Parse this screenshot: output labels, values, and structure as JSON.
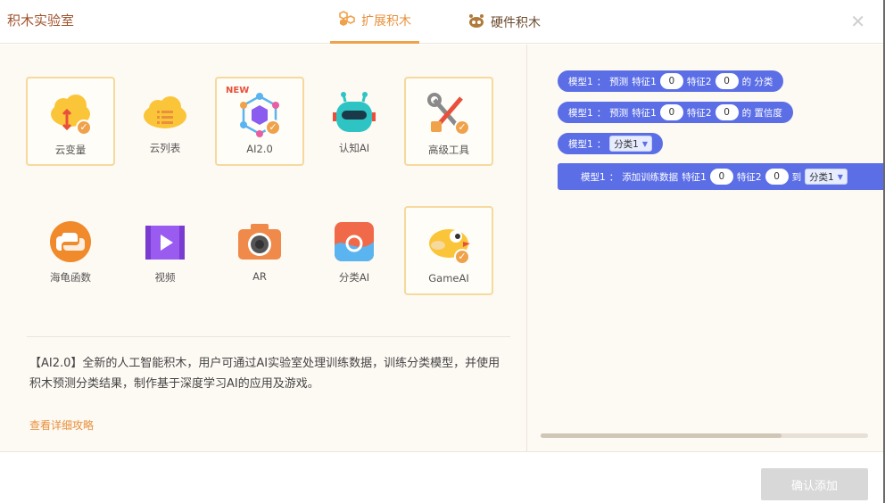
{
  "header": {
    "title": "积木实验室",
    "tabs": [
      {
        "label": "扩展积木",
        "active": true
      },
      {
        "label": "硬件积木",
        "active": false
      }
    ],
    "close": "✕"
  },
  "extensions": [
    {
      "label": "云变量",
      "selected": true
    },
    {
      "label": "云列表",
      "selected": false
    },
    {
      "label": "AI2.0",
      "selected": true,
      "badge": "NEW"
    },
    {
      "label": "认知AI",
      "selected": false
    },
    {
      "label": "高级工具",
      "selected": true
    },
    {
      "label": "海龟函数",
      "selected": false
    },
    {
      "label": "视频",
      "selected": false
    },
    {
      "label": "AR",
      "selected": false
    },
    {
      "label": "分类AI",
      "selected": false
    },
    {
      "label": "GameAI",
      "selected": true
    }
  ],
  "description": "【AI2.0】全新的人工智能积木，用户可通过AI实验室处理训练数据，训练分类模型，并使用积木预测分类结果，制作基于深度学习AI的应用及游戏。",
  "more_link": "查看详细攻略",
  "blocks": {
    "b1": {
      "model": "模型1",
      "sep": "：",
      "predict": "预测",
      "f1": "特征1",
      "v1": "0",
      "f2": "特征2",
      "v2": "0",
      "tail": "的 分类"
    },
    "b2": {
      "model": "模型1",
      "sep": "：",
      "predict": "预测",
      "f1": "特征1",
      "v1": "0",
      "f2": "特征2",
      "v2": "0",
      "tail": "的 置信度"
    },
    "b3": {
      "model": "模型1",
      "sep": "：",
      "class": "分类1"
    },
    "b4": {
      "model": "模型1",
      "sep": "：",
      "action": "添加训练数据",
      "f1": "特征1",
      "v1": "0",
      "f2": "特征2",
      "v2": "0",
      "to": "到",
      "class": "分类1"
    }
  },
  "footer": {
    "confirm": "确认添加"
  },
  "colors": {
    "accent": "#f0a24a",
    "block": "#5b6ee6",
    "confirm_disabled": "#d8d8d8"
  }
}
